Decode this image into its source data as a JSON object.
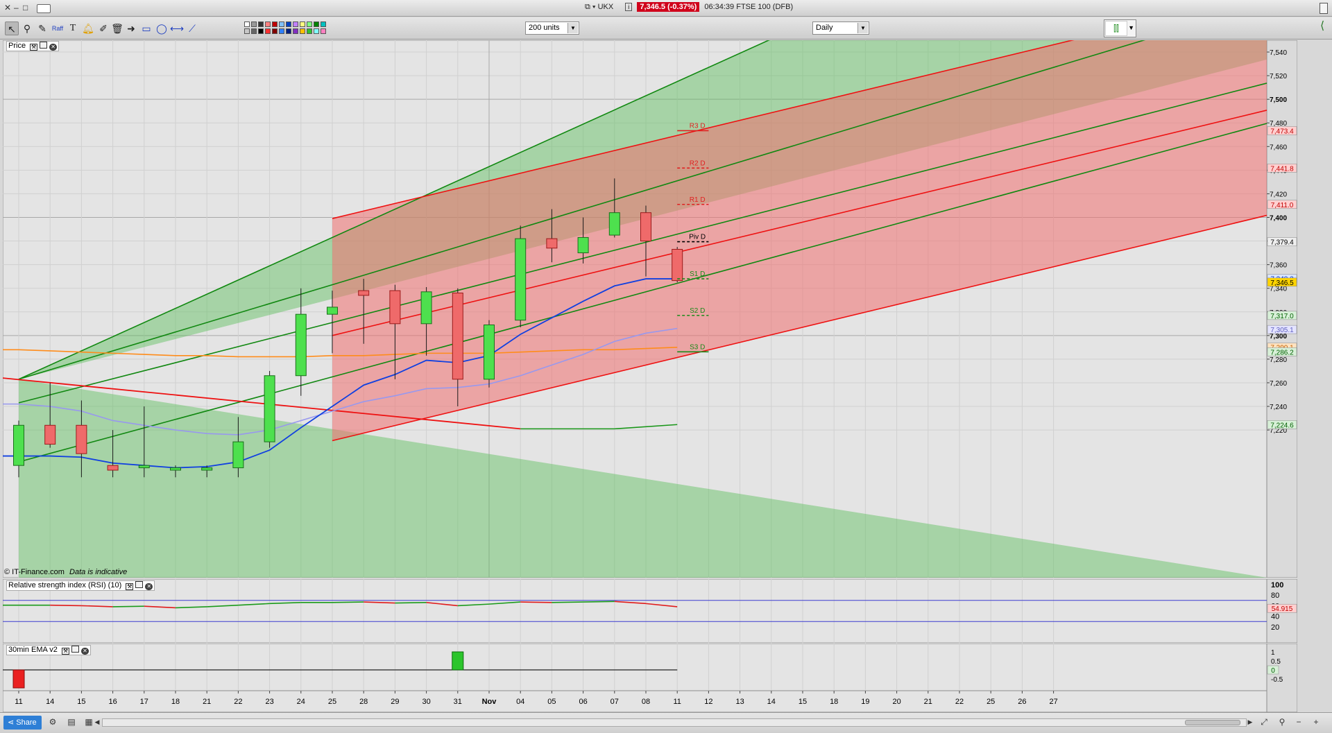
{
  "window": {
    "ticker_symbol": "UKX",
    "ticker_price": "7,346.5 (-0.37%)",
    "ticker_time_name": "06:34:39 FTSE 100 (DFB)"
  },
  "toolbar": {
    "tools": [
      "pointer-icon",
      "zoom-icon",
      "draw-icon",
      "fib-icon",
      "text-icon",
      "alert-bell-icon",
      "pencil-icon",
      "trash-icon",
      "arrow-icon",
      "rectangle-icon",
      "ellipse-icon",
      "horizontal-line-icon",
      "trend-line-icon"
    ],
    "palette": [
      "#ffffff",
      "#c8c8c8",
      "#999999",
      "#666666",
      "#333333",
      "#000000",
      "#ff8080",
      "#ff3030",
      "#c00000",
      "#800000",
      "#80c0ff",
      "#3080ff",
      "#0040c0",
      "#002080",
      "#c080ff",
      "#8030c0",
      "#ffff80",
      "#ffc000",
      "#80ff80",
      "#30c030",
      "#008000",
      "#80ffff",
      "#00c0c0",
      "#ff80c0"
    ],
    "units_select": "200 units",
    "interval_select": "Daily",
    "fib_label": "Raff"
  },
  "panels": {
    "price_label": "Price",
    "rsi_label": "Relative strength index (RSI) (10)",
    "ema_label": "30min EMA v2",
    "watermark": "© IT-Finance.com",
    "watermark_note": "Data is indicative"
  },
  "chart_data": {
    "type": "candlestick",
    "x_categories": [
      "11",
      "14",
      "15",
      "16",
      "17",
      "18",
      "21",
      "22",
      "23",
      "24",
      "25",
      "28",
      "29",
      "30",
      "31",
      "Nov",
      "04",
      "05",
      "06",
      "07",
      "08",
      "11"
    ],
    "x_future_ticks": [
      "12",
      "13",
      "14",
      "15",
      "18",
      "19",
      "20",
      "21",
      "22",
      "25",
      "26",
      "27"
    ],
    "ylim": [
      7186,
      7550
    ],
    "y_ticks": [
      7220,
      7240,
      7260,
      7280,
      7300,
      7320,
      7340,
      7360,
      7380,
      7400,
      7420,
      7440,
      7460,
      7480,
      7500,
      7520,
      7540
    ],
    "candles": [
      {
        "x": "11",
        "o": 7190,
        "h": 7228,
        "l": 7180,
        "c": 7224
      },
      {
        "x": "14",
        "o": 7224,
        "h": 7260,
        "l": 7205,
        "c": 7208
      },
      {
        "x": "15",
        "o": 7224,
        "h": 7245,
        "l": 7180,
        "c": 7200
      },
      {
        "x": "16",
        "o": 7190,
        "h": 7220,
        "l": 7180,
        "c": 7186
      },
      {
        "x": "17",
        "o": 7188,
        "h": 7240,
        "l": 7180,
        "c": 7190
      },
      {
        "x": "18",
        "o": 7186,
        "h": 7190,
        "l": 7180,
        "c": 7188
      },
      {
        "x": "21",
        "o": 7186,
        "h": 7190,
        "l": 7180,
        "c": 7188
      },
      {
        "x": "22",
        "o": 7188,
        "h": 7231,
        "l": 7180,
        "c": 7210
      },
      {
        "x": "23",
        "o": 7210,
        "h": 7270,
        "l": 7205,
        "c": 7266
      },
      {
        "x": "24",
        "o": 7266,
        "h": 7340,
        "l": 7249,
        "c": 7318
      },
      {
        "x": "25",
        "o": 7318,
        "h": 7338,
        "l": 7285,
        "c": 7324
      },
      {
        "x": "28",
        "o": 7338,
        "h": 7348,
        "l": 7293,
        "c": 7334
      },
      {
        "x": "29",
        "o": 7338,
        "h": 7343,
        "l": 7263,
        "c": 7310
      },
      {
        "x": "30",
        "o": 7310,
        "h": 7341,
        "l": 7283,
        "c": 7337
      },
      {
        "x": "31",
        "o": 7336,
        "h": 7340,
        "l": 7240,
        "c": 7263
      },
      {
        "x": "Nov",
        "o": 7263,
        "h": 7313,
        "l": 7256,
        "c": 7309
      },
      {
        "x": "04",
        "o": 7313,
        "h": 7393,
        "l": 7307,
        "c": 7382
      },
      {
        "x": "05",
        "o": 7382,
        "h": 7407,
        "l": 7362,
        "c": 7374
      },
      {
        "x": "06",
        "o": 7370,
        "h": 7400,
        "l": 7361,
        "c": 7383
      },
      {
        "x": "07",
        "o": 7385,
        "h": 7433,
        "l": 7383,
        "c": 7404
      },
      {
        "x": "08",
        "o": 7404,
        "h": 7410,
        "l": 7350,
        "c": 7380
      },
      {
        "x": "11",
        "o": 7373,
        "h": 7375,
        "l": 7345,
        "c": 7346.5
      }
    ],
    "pivots": [
      {
        "label": "R3 D",
        "value": 7473.4,
        "color": "#e02020",
        "style": "solid"
      },
      {
        "label": "R2 D",
        "value": 7441.8,
        "color": "#e02020",
        "style": "dashed"
      },
      {
        "label": "R1 D",
        "value": 7411.0,
        "color": "#e02020",
        "style": "dashed"
      },
      {
        "label": "Piv D",
        "value": 7379.4,
        "color": "#000000",
        "style": "dashed"
      },
      {
        "label": "S1 D",
        "value": 7348.0,
        "color": "#1a8a1a",
        "style": "dashed"
      },
      {
        "label": "S2 D",
        "value": 7317.0,
        "color": "#1a8a1a",
        "style": "dashed"
      },
      {
        "label": "S3 D",
        "value": 7286.2,
        "color": "#1a8a1a",
        "style": "solid"
      }
    ],
    "price_tags": [
      {
        "text": "7,473.4",
        "value": 7473.4,
        "bg": "#ffd0d0",
        "fg": "#c00000"
      },
      {
        "text": "7,441.8",
        "value": 7441.8,
        "bg": "#ffd0d0",
        "fg": "#c00000"
      },
      {
        "text": "7,411.0",
        "value": 7411.0,
        "bg": "#ffd0d0",
        "fg": "#c00000"
      },
      {
        "text": "7,379.4",
        "value": 7379.4,
        "bg": "#eeeeee",
        "fg": "#000000"
      },
      {
        "text": "7,348.2",
        "value": 7348.2,
        "bg": "#d8e4ff",
        "fg": "#0030c0"
      },
      {
        "text": "7,346.5",
        "value": 7345.2,
        "bg": "#ffd400",
        "fg": "#000000"
      },
      {
        "text": "7,317.0",
        "value": 7317.0,
        "bg": "#d8f0d8",
        "fg": "#006000"
      },
      {
        "text": "7,305.1",
        "value": 7305.1,
        "bg": "#e4e4ff",
        "fg": "#6060c0"
      },
      {
        "text": "7,290.1",
        "value": 7290.1,
        "bg": "#ffe2c0",
        "fg": "#c06000"
      },
      {
        "text": "7,286.2",
        "value": 7286.2,
        "bg": "#d8f0d8",
        "fg": "#006000"
      },
      {
        "text": "7,224.6",
        "value": 7224.6,
        "bg": "#d8f0d8",
        "fg": "#006000"
      }
    ],
    "ema_fast": [
      7198,
      7198,
      7197,
      7192,
      7190,
      7188,
      7189,
      7193,
      7203,
      7222,
      7240,
      7258,
      7267,
      7279,
      7277,
      7283,
      7301,
      7315,
      7329,
      7342,
      7348,
      7348
    ],
    "ema_mid": [
      7242,
      7240,
      7236,
      7228,
      7224,
      7220,
      7217,
      7216,
      7220,
      7228,
      7236,
      7244,
      7249,
      7255,
      7256,
      7259,
      7266,
      7275,
      7284,
      7295,
      7302,
      7306
    ],
    "sma_orange": [
      7288,
      7287,
      7286,
      7285,
      7284,
      7283,
      7283,
      7282,
      7282,
      7282,
      7283,
      7283,
      7284,
      7285,
      7285,
      7285,
      7286,
      7287,
      7288,
      7288,
      7289,
      7290
    ],
    "sma_long": {
      "start_value": 7272,
      "start_x": "11",
      "min_value": 7221,
      "end_value": 7224.6
    },
    "channels": {
      "green_start": {
        "x": "11",
        "lower": 7263,
        "upper": 7263,
        "slope_per_day": 7.1
      },
      "red_start": {
        "x": "25",
        "lower": 7211,
        "upper": 7399,
        "slope_per_day": 6.4
      }
    },
    "rsi": {
      "ylim": [
        0,
        100
      ],
      "ticks": [
        20,
        40,
        60,
        80,
        100
      ],
      "levels": [
        30,
        70
      ],
      "current_label": "54.915",
      "values": [
        61,
        61,
        60,
        58,
        59,
        56,
        58,
        61,
        64,
        66,
        66,
        67,
        65,
        66,
        60,
        63,
        67,
        66,
        67,
        68,
        64,
        58
      ]
    },
    "ema_signal": {
      "ylim": [
        -1,
        1
      ],
      "ticks": [
        "1",
        "0.5",
        "0",
        "-0.5"
      ],
      "current_label": "0",
      "bars": [
        {
          "x": "11",
          "value": -1
        },
        {
          "x": "31",
          "value": 1
        }
      ]
    }
  }
}
